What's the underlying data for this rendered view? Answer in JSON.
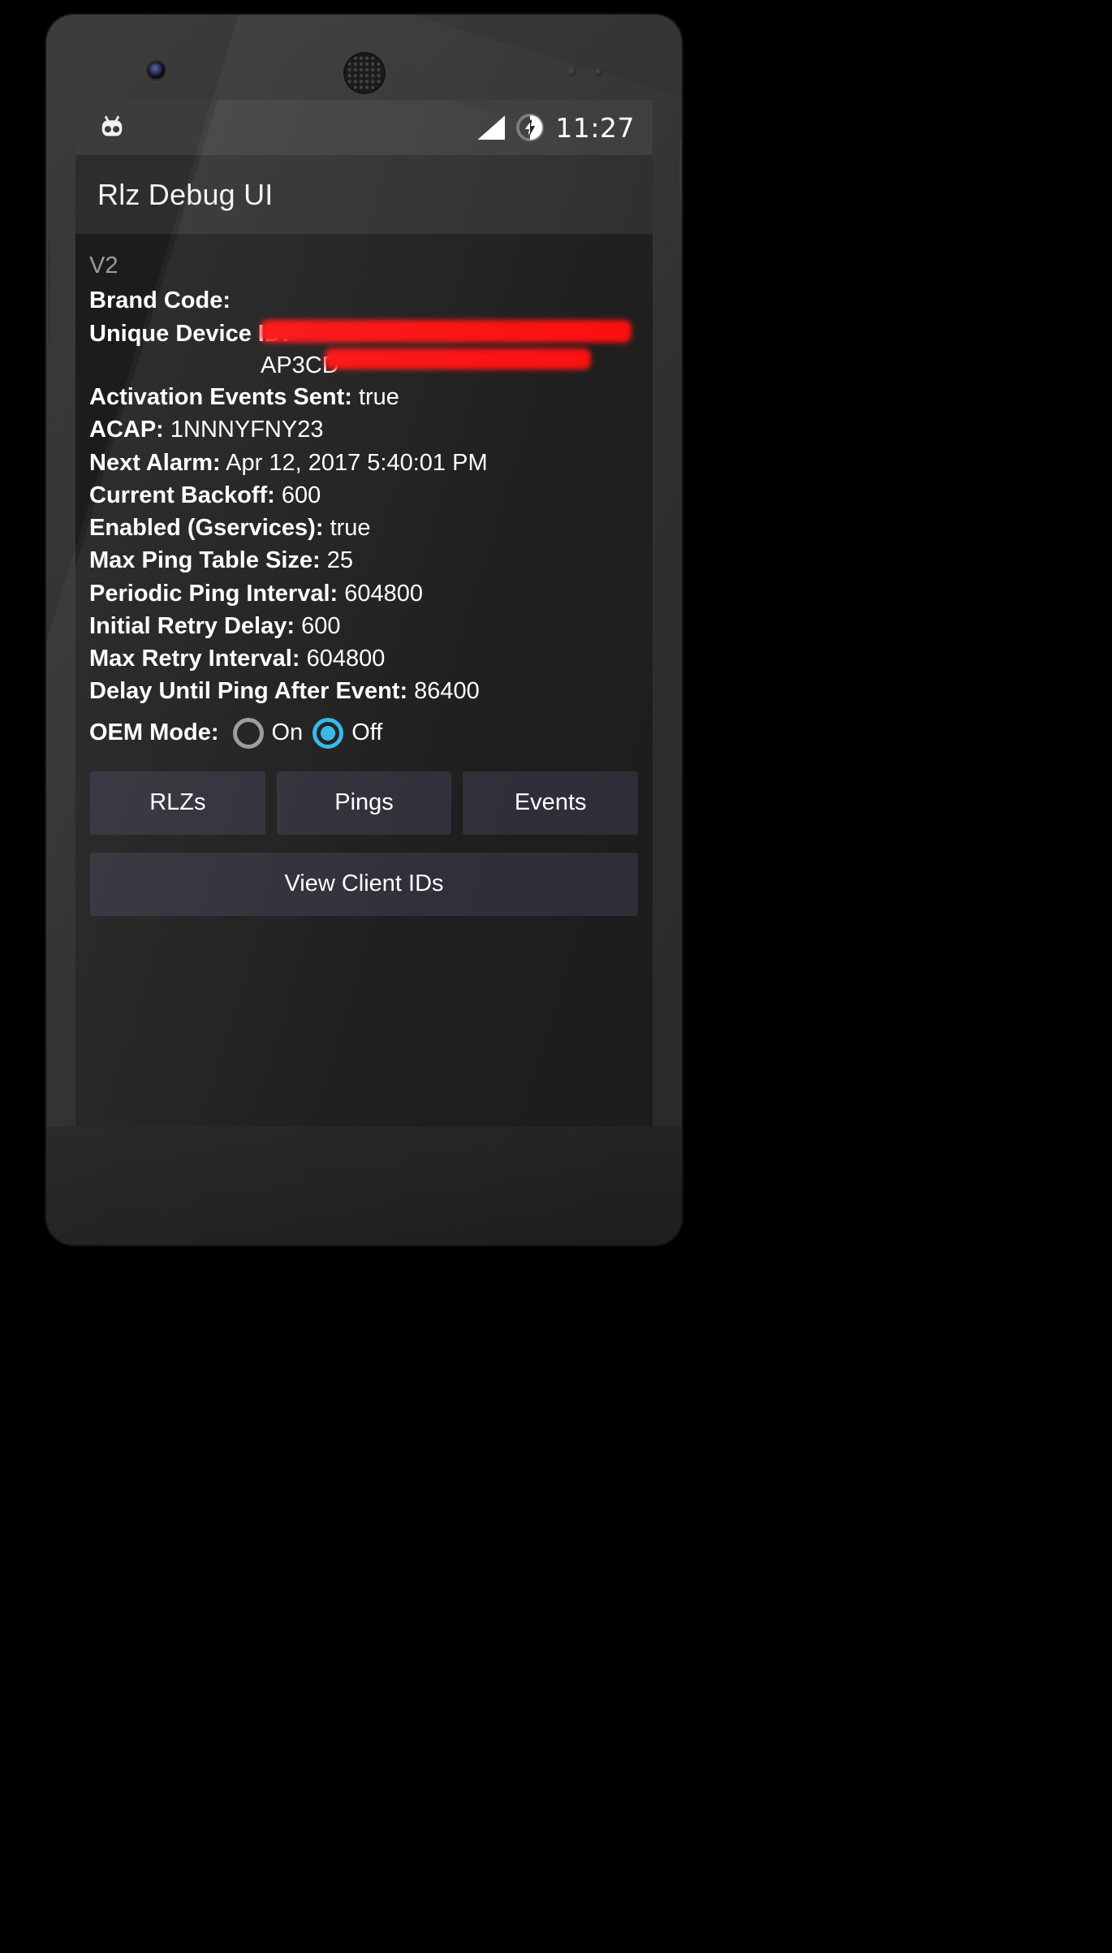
{
  "status_bar": {
    "notification_icon": "cyanogenmod-logo-icon",
    "signal_icon": "signal-bars-icon",
    "battery_icon": "battery-charging-icon",
    "time": "11:27"
  },
  "action_bar": {
    "title": "Rlz Debug UI"
  },
  "content": {
    "version": "V2",
    "rows": [
      {
        "label": "Brand Code:",
        "value": ""
      },
      {
        "label": "Activation Events Sent:",
        "value": "true"
      },
      {
        "label": "ACAP:",
        "value": "1NNNYFNY23"
      },
      {
        "label": "Next Alarm:",
        "value": "Apr 12, 2017 5:40:01 PM"
      },
      {
        "label": "Current Backoff:",
        "value": "600"
      },
      {
        "label": "Enabled (Gservices):",
        "value": "true"
      },
      {
        "label": "Max Ping Table Size:",
        "value": "25"
      },
      {
        "label": "Periodic Ping Interval:",
        "value": "604800"
      },
      {
        "label": "Initial Retry Delay:",
        "value": "600"
      },
      {
        "label": "Max Retry Interval:",
        "value": "604800"
      },
      {
        "label": "Delay Until Ping After Event:",
        "value": "86400"
      }
    ],
    "unique_device_id": {
      "label": "Unique Device ID:",
      "value_line1": "",
      "value_line2": "AP3CD",
      "redacted": true,
      "redaction_color": "#fb0d0d"
    },
    "oem_mode": {
      "label": "OEM Mode:",
      "options": [
        {
          "label": "On",
          "selected": false
        },
        {
          "label": "Off",
          "selected": true
        }
      ],
      "accent_color": "#33b5e5"
    },
    "buttons": {
      "rlzs": "RLZs",
      "pings": "Pings",
      "events": "Events",
      "view_client_ids": "View Client IDs"
    }
  }
}
